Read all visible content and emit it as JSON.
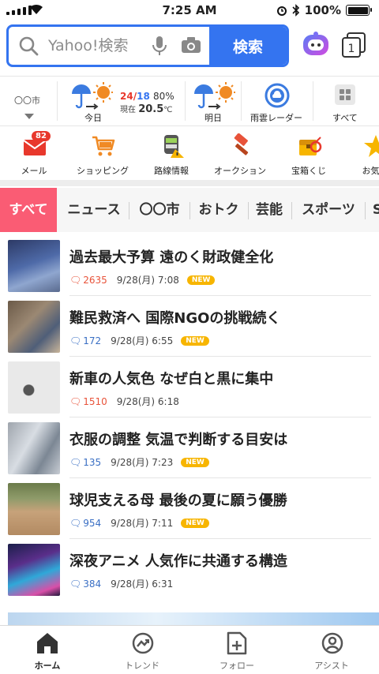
{
  "status_bar": {
    "time": "7:25 AM",
    "battery": "100%"
  },
  "search": {
    "placeholder": "Yahoo!検索",
    "button_label": "検索",
    "tab_count": "1"
  },
  "weather": {
    "city": "〇〇市",
    "today_label": "今日",
    "temp_high": "24",
    "temp_low": "18",
    "humidity": "80%",
    "current_label": "現在",
    "current_temp": "20.5",
    "current_unit": "℃",
    "tomorrow_label": "明日",
    "radar_label": "雨雲レーダー",
    "all_label": "すべて"
  },
  "services": [
    {
      "label": "メール",
      "badge": "82"
    },
    {
      "label": "ショッピング"
    },
    {
      "label": "路線情報"
    },
    {
      "label": "オークション"
    },
    {
      "label": "宝箱くじ"
    },
    {
      "label": "お気に"
    }
  ],
  "categories": [
    "すべて",
    "ニュース",
    "〇〇市",
    "おトク",
    "芸能",
    "スポーツ",
    "S"
  ],
  "new_label": "NEW",
  "news": [
    {
      "title": "過去最大予算 遠のく財政健全化",
      "comments": "2635",
      "comment_color": "red",
      "date": "9/28(月) 7:08",
      "new": true
    },
    {
      "title": "難民救済へ 国際NGOの挑戦続く",
      "comments": "172",
      "comment_color": "blue",
      "date": "9/28(月) 6:55",
      "new": true
    },
    {
      "title": "新車の人気色 なぜ白と黒に集中",
      "comments": "1510",
      "comment_color": "red",
      "date": "9/28(月) 6:18",
      "new": false
    },
    {
      "title": "衣服の調整 気温で判断する目安は",
      "comments": "135",
      "comment_color": "blue",
      "date": "9/28(月) 7:23",
      "new": true
    },
    {
      "title": "球児支える母 最後の夏に願う優勝",
      "comments": "954",
      "comment_color": "blue",
      "date": "9/28(月) 7:11",
      "new": true
    },
    {
      "title": "深夜アニメ 人気作に共通する構造",
      "comments": "384",
      "comment_color": "blue",
      "date": "9/28(月) 6:31",
      "new": false
    }
  ],
  "bottom_nav": [
    {
      "label": "ホーム"
    },
    {
      "label": "トレンド"
    },
    {
      "label": "フォロー"
    },
    {
      "label": "アシスト"
    }
  ],
  "colors": {
    "accent": "#3474f0",
    "tab_active": "#fa5c74",
    "new_badge": "#f7b500",
    "comment_red": "#e8533a",
    "comment_blue": "#3a6fc4"
  }
}
